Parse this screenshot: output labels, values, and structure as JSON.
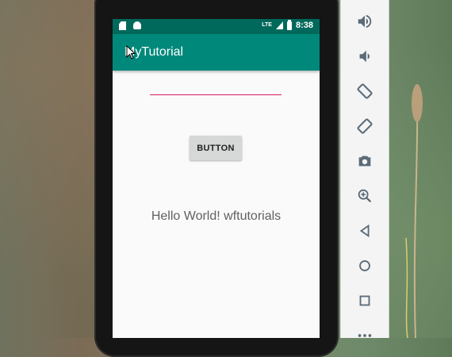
{
  "status_bar": {
    "time": "8:38",
    "network_label": "LTE"
  },
  "app": {
    "title": "MyTutorial",
    "button_label": "BUTTON",
    "hello_text": "Hello World! wftutorials",
    "edit_text_value": ""
  },
  "emulator_toolbar": {
    "tools": [
      {
        "name": "volume-up-icon"
      },
      {
        "name": "volume-down-icon"
      },
      {
        "name": "rotate-left-icon"
      },
      {
        "name": "rotate-right-icon"
      },
      {
        "name": "camera-icon"
      },
      {
        "name": "zoom-icon"
      },
      {
        "name": "back-icon"
      },
      {
        "name": "home-icon"
      },
      {
        "name": "overview-icon"
      },
      {
        "name": "more-icon"
      }
    ]
  },
  "colors": {
    "status_bar": "#00695c",
    "app_bar": "#00897b",
    "edit_text_underline": "#d81b60",
    "button_bg": "#d6d7d7"
  }
}
